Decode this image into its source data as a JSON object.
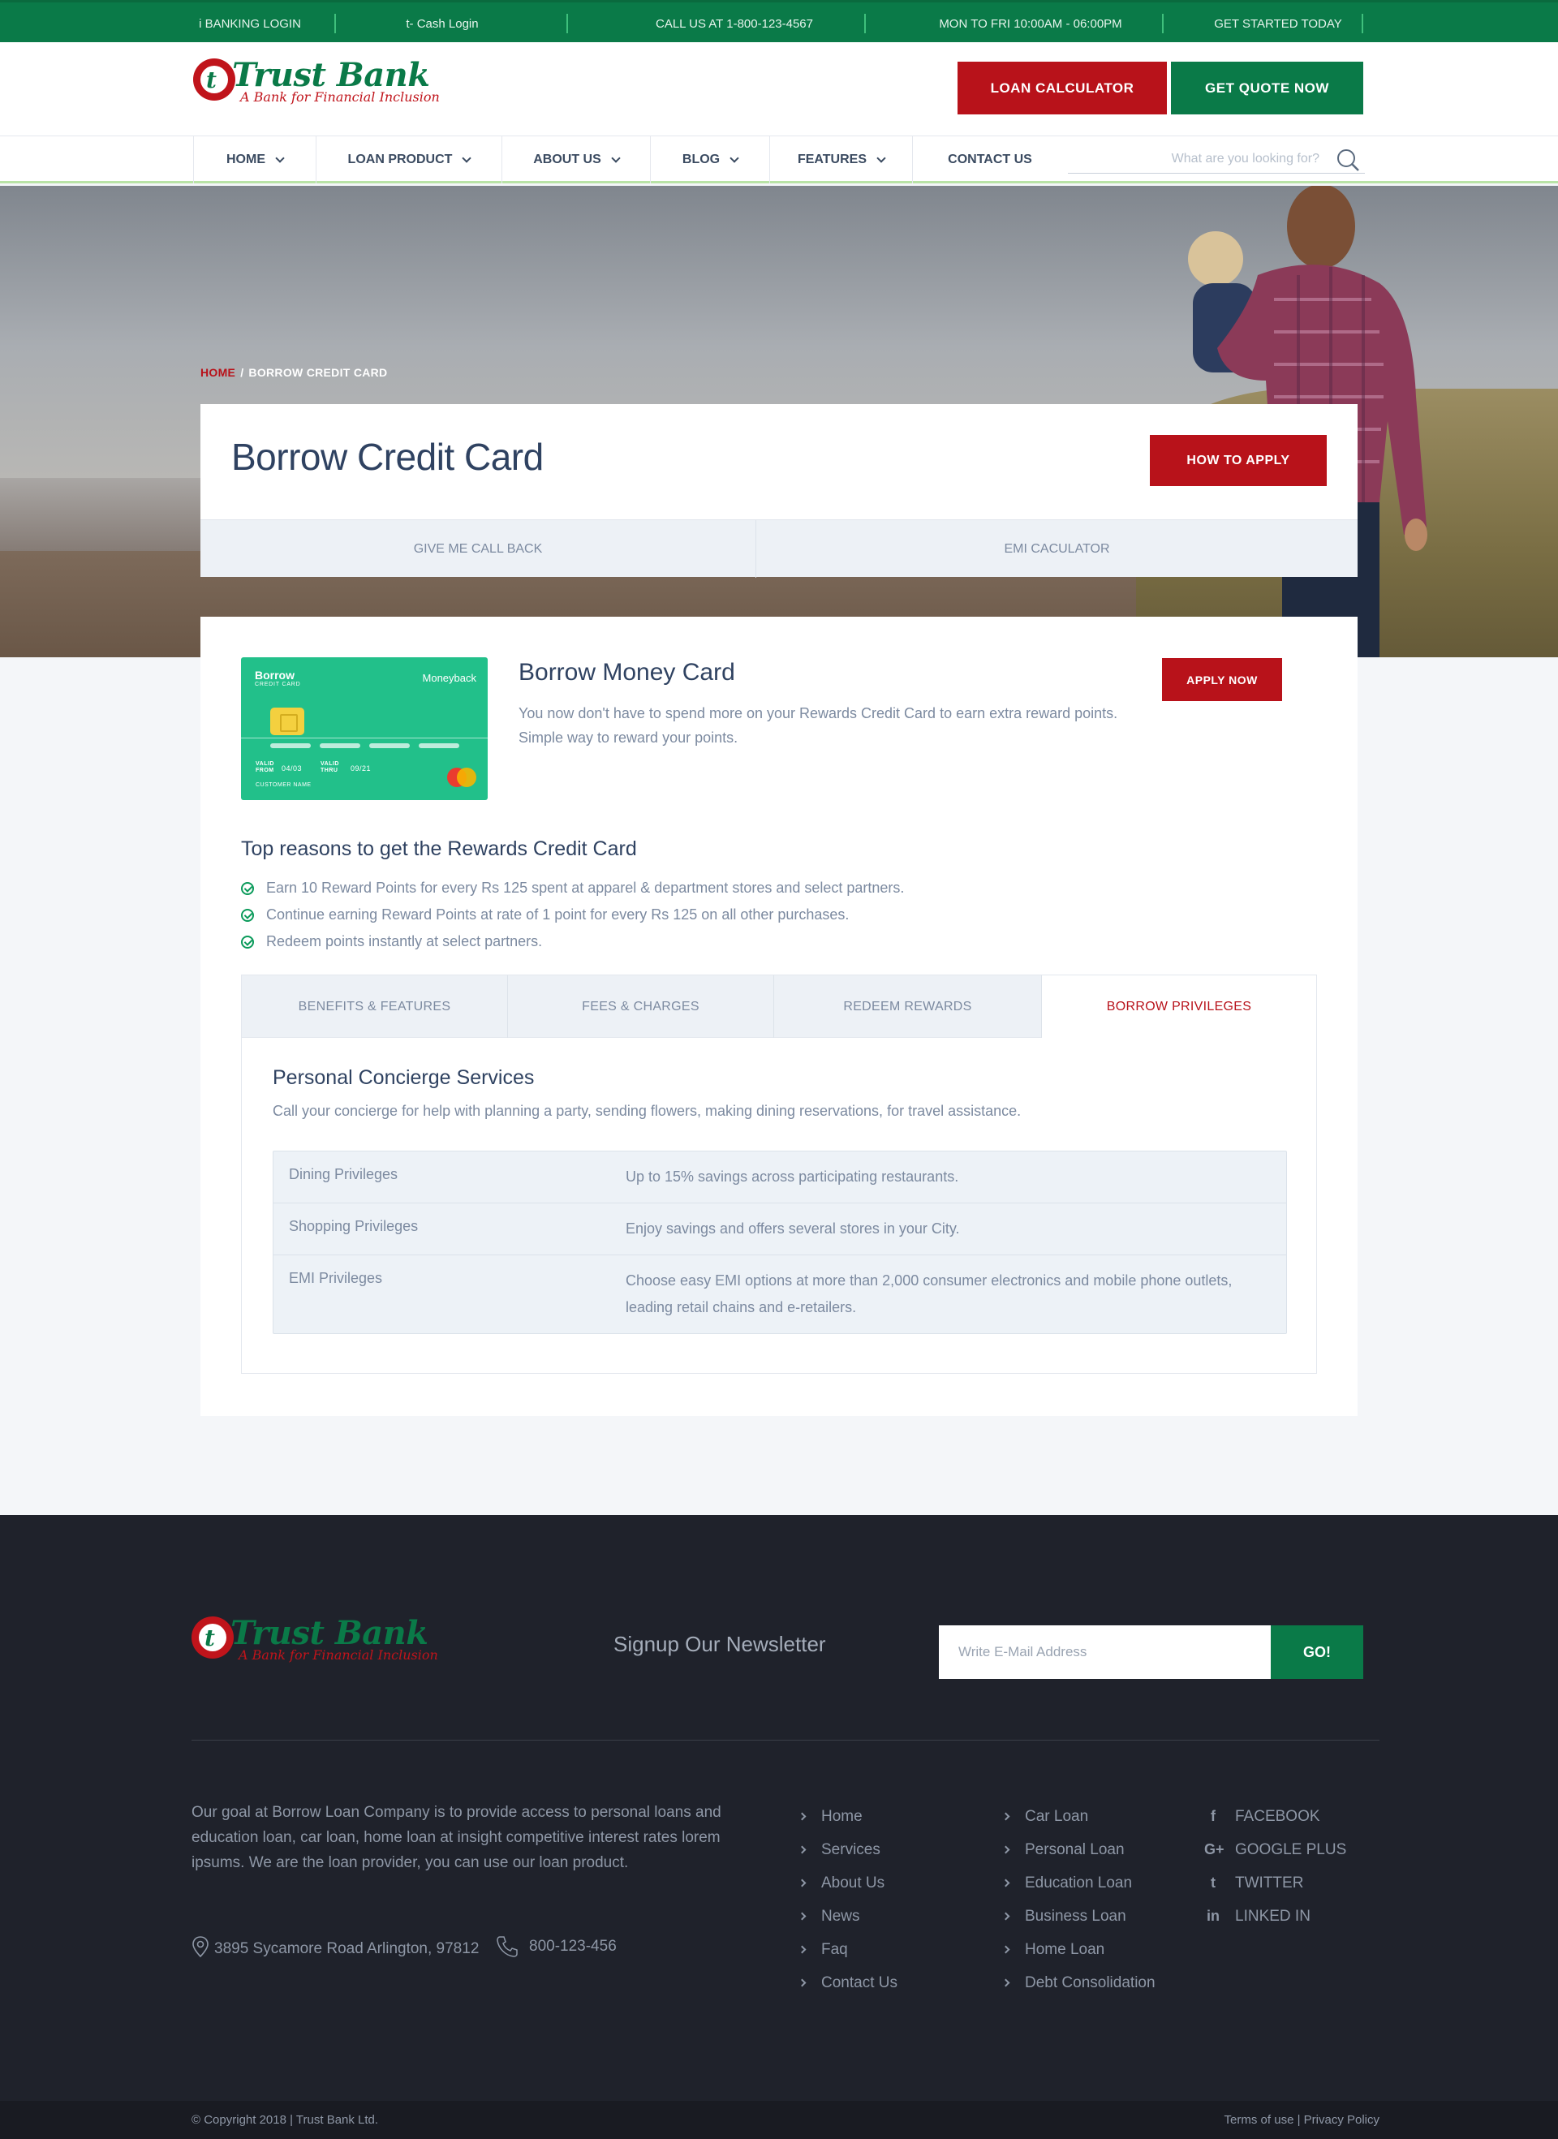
{
  "topbar": {
    "ibanking": "i BANKING LOGIN",
    "tcash": "t- Cash Login",
    "call": "CALL US AT 1-800-123-4567",
    "hours": "MON TO FRI 10:00AM - 06:00PM",
    "started": "GET STARTED TODAY"
  },
  "brand": {
    "name": "Trust Bank",
    "tagline": "A Bank for Financial Inclusion",
    "mark": "t"
  },
  "header": {
    "loan_calculator": "LOAN CALCULATOR",
    "get_quote": "GET QUOTE NOW"
  },
  "nav": {
    "items": [
      {
        "label": "HOME"
      },
      {
        "label": "LOAN PRODUCT"
      },
      {
        "label": "ABOUT US"
      },
      {
        "label": "BLOG"
      },
      {
        "label": "FEATURES"
      },
      {
        "label": "CONTACT US"
      }
    ],
    "search_placeholder": "What are you looking for?"
  },
  "breadcrumb": {
    "home": "HOME",
    "separator": "/",
    "current": "BORROW CREDIT CARD"
  },
  "page": {
    "title": "Borrow Credit Card",
    "how_to_apply": "HOW TO APPLY",
    "call_back": "GIVE ME CALL BACK",
    "emi": "EMI CACULATOR"
  },
  "product": {
    "card": {
      "brand": "Borrow",
      "sub": "CREDIT CARD",
      "moneyback": "Moneyback",
      "valid_from_label": "VALID FROM",
      "valid_from": "04/03",
      "valid_thru_label": "VALID THRU",
      "valid_thru": "09/21",
      "customer": "CUSTOMER NAME"
    },
    "title": "Borrow Money Card",
    "description": "You now don't have to spend more on your Rewards Credit Card to earn extra reward points. Simple way to reward your points.",
    "apply_now": "APPLY NOW"
  },
  "reasons": {
    "title": "Top reasons to get the Rewards Credit Card",
    "items": [
      "Earn 10 Reward Points for every Rs 125 spent at apparel & department stores and select partners.",
      "Continue earning Reward Points at rate of 1 point for every Rs 125 on all other purchases.",
      "Redeem points instantly at select partners."
    ]
  },
  "tabs": {
    "items": [
      "BENEFITS & FEATURES",
      "FEES & CHARGES",
      "REDEEM REWARDS",
      "BORROW PRIVILEGES"
    ],
    "active": 3,
    "content": {
      "title": "Personal Concierge Services",
      "description": "Call your concierge for help with planning a party, sending flowers, making dining reservations, for travel assistance.",
      "rows": [
        {
          "key": "Dining Privileges",
          "value": "Up to 15% savings across participating restaurants."
        },
        {
          "key": "Shopping Privileges",
          "value": "Enjoy savings and offers several stores in your City."
        },
        {
          "key": "EMI Privileges",
          "value": "Choose easy EMI options at more than 2,000 consumer electronics and mobile phone outlets, leading retail chains and e-retailers."
        }
      ]
    }
  },
  "footer": {
    "newsletter_title": "Signup Our Newsletter",
    "email_placeholder": "Write E-Mail Address",
    "go": "GO!",
    "about": "Our goal at Borrow Loan Company is to provide access to personal loans and education loan, car loan, home loan at insight competitive interest rates lorem ipsums. We are the loan provider, you can use our loan product.",
    "address": "3895 Sycamore Road Arlington, 97812",
    "phone": "800-123-456",
    "links1": [
      "Home",
      "Services",
      "About Us",
      "News",
      "Faq",
      "Contact Us"
    ],
    "links2": [
      "Car Loan",
      "Personal Loan",
      "Education Loan",
      "Business Loan",
      "Home Loan",
      "Debt Consolidation"
    ],
    "social": [
      {
        "icon": "facebook-icon",
        "glyph": "f",
        "label": "FACEBOOK"
      },
      {
        "icon": "google-plus-icon",
        "glyph": "G+",
        "label": "GOOGLE PLUS"
      },
      {
        "icon": "twitter-icon",
        "glyph": "t",
        "label": "TWITTER"
      },
      {
        "icon": "linkedin-icon",
        "glyph": "in",
        "label": "LINKED IN"
      }
    ],
    "copyright": "© Copyright 2018 | Trust Bank Ltd.",
    "terms": "Terms of use | Privacy Policy"
  },
  "colors": {
    "brand_green": "#0a7a48",
    "brand_red": "#b8121a",
    "footer_bg": "#1f222b",
    "card_green": "#22c08a"
  }
}
